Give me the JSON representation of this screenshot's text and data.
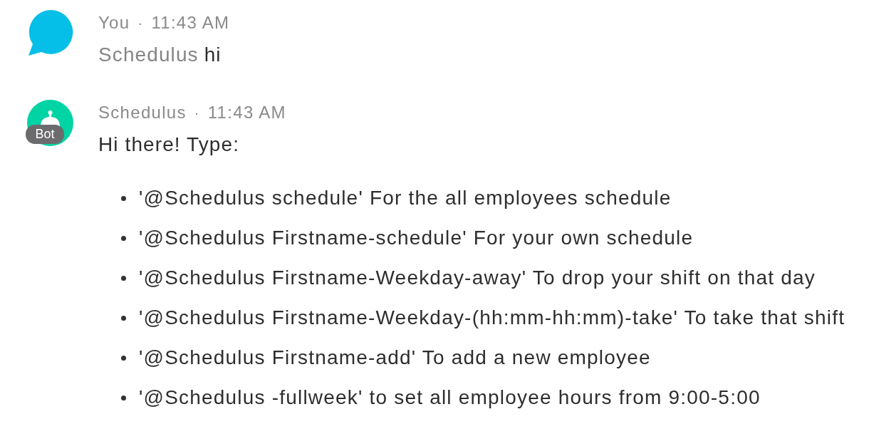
{
  "messages": [
    {
      "sender": "You",
      "separator": "·",
      "time": "11:43 AM",
      "avatar": {
        "kind": "user"
      },
      "body": [
        {
          "kind": "mention",
          "text": "Schedulus"
        },
        {
          "kind": "text",
          "text": "hi"
        }
      ]
    },
    {
      "sender": "Schedulus",
      "separator": "·",
      "time": "11:43 AM",
      "avatar": {
        "kind": "bot",
        "badge": "Bot"
      },
      "body": [
        {
          "kind": "text",
          "text": "Hi there! Type:"
        }
      ],
      "list": [
        "'@Schedulus schedule' For the all employees schedule",
        "'@Schedulus Firstname-schedule' For your own schedule",
        "'@Schedulus Firstname-Weekday-away' To drop your shift on that day",
        "'@Schedulus Firstname-Weekday-(hh:mm-hh:mm)-take' To take that shift",
        "'@Schedulus Firstname-add' To add a new employee",
        "'@Schedulus -fullweek' to set all employee hours from 9:00-5:00"
      ]
    }
  ]
}
